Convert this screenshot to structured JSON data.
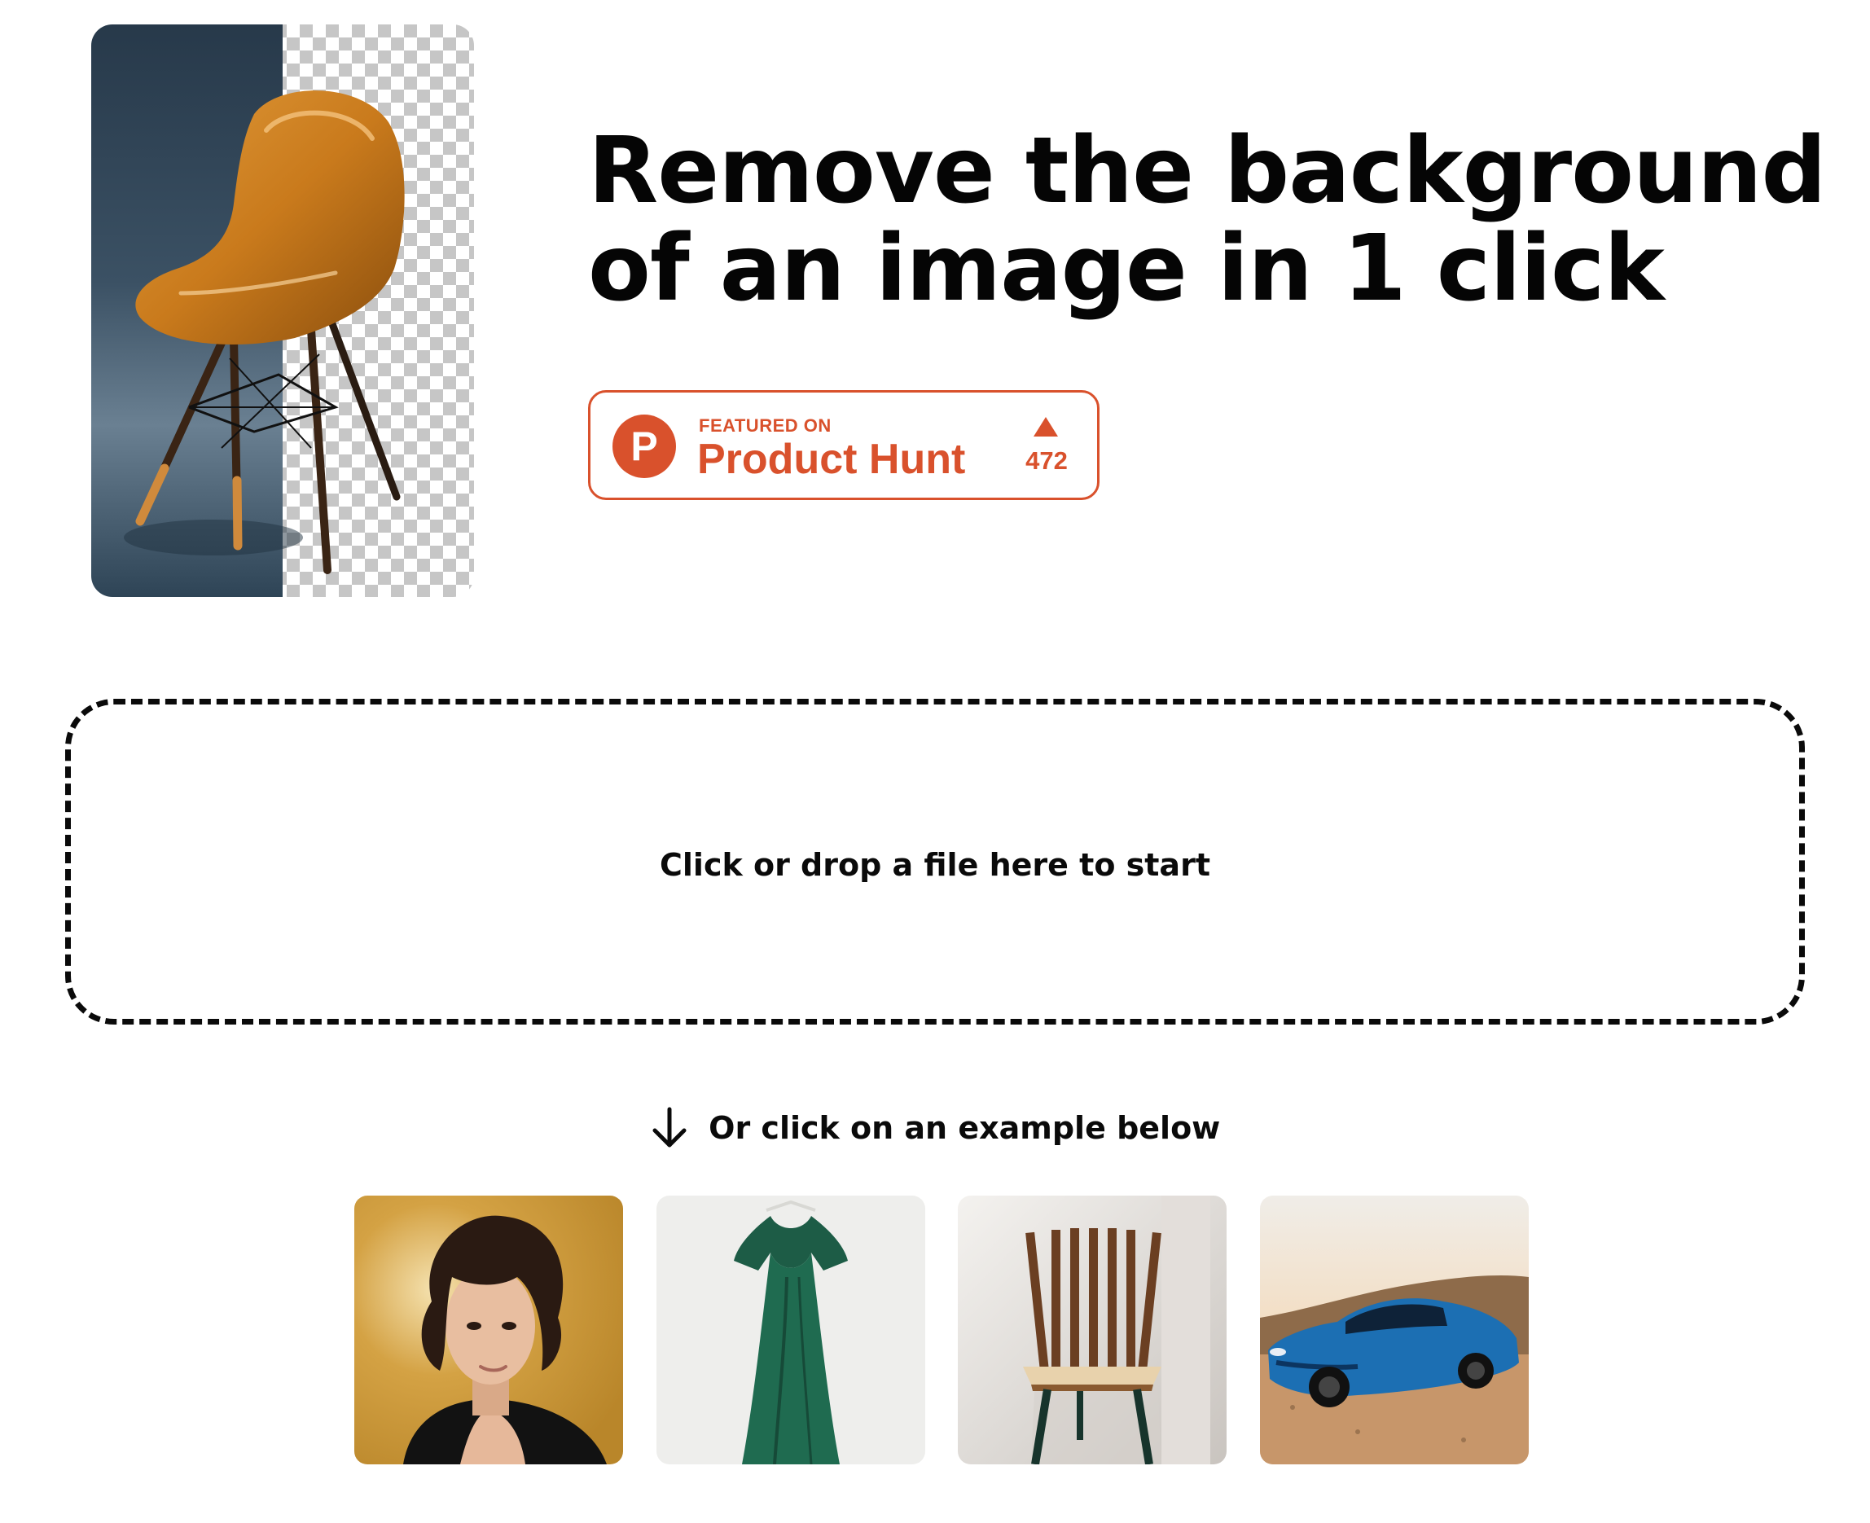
{
  "hero": {
    "image_icon": "chair-background-removal-preview",
    "title_line1": "Remove the background",
    "title_line2": "of an image in 1 click"
  },
  "product_hunt": {
    "logo_letter": "P",
    "featured_label": "FEATURED ON",
    "name": "Product Hunt",
    "upvotes": "472",
    "accent_color": "#d9512c"
  },
  "dropzone": {
    "text": "Click or drop a file here to start"
  },
  "examples": {
    "hint_icon": "arrow-down-icon",
    "hint_text": "Or click on an example below",
    "items": [
      {
        "subject": "woman-portrait"
      },
      {
        "subject": "green-dress"
      },
      {
        "subject": "wooden-chair"
      },
      {
        "subject": "blue-sports-car"
      }
    ]
  }
}
